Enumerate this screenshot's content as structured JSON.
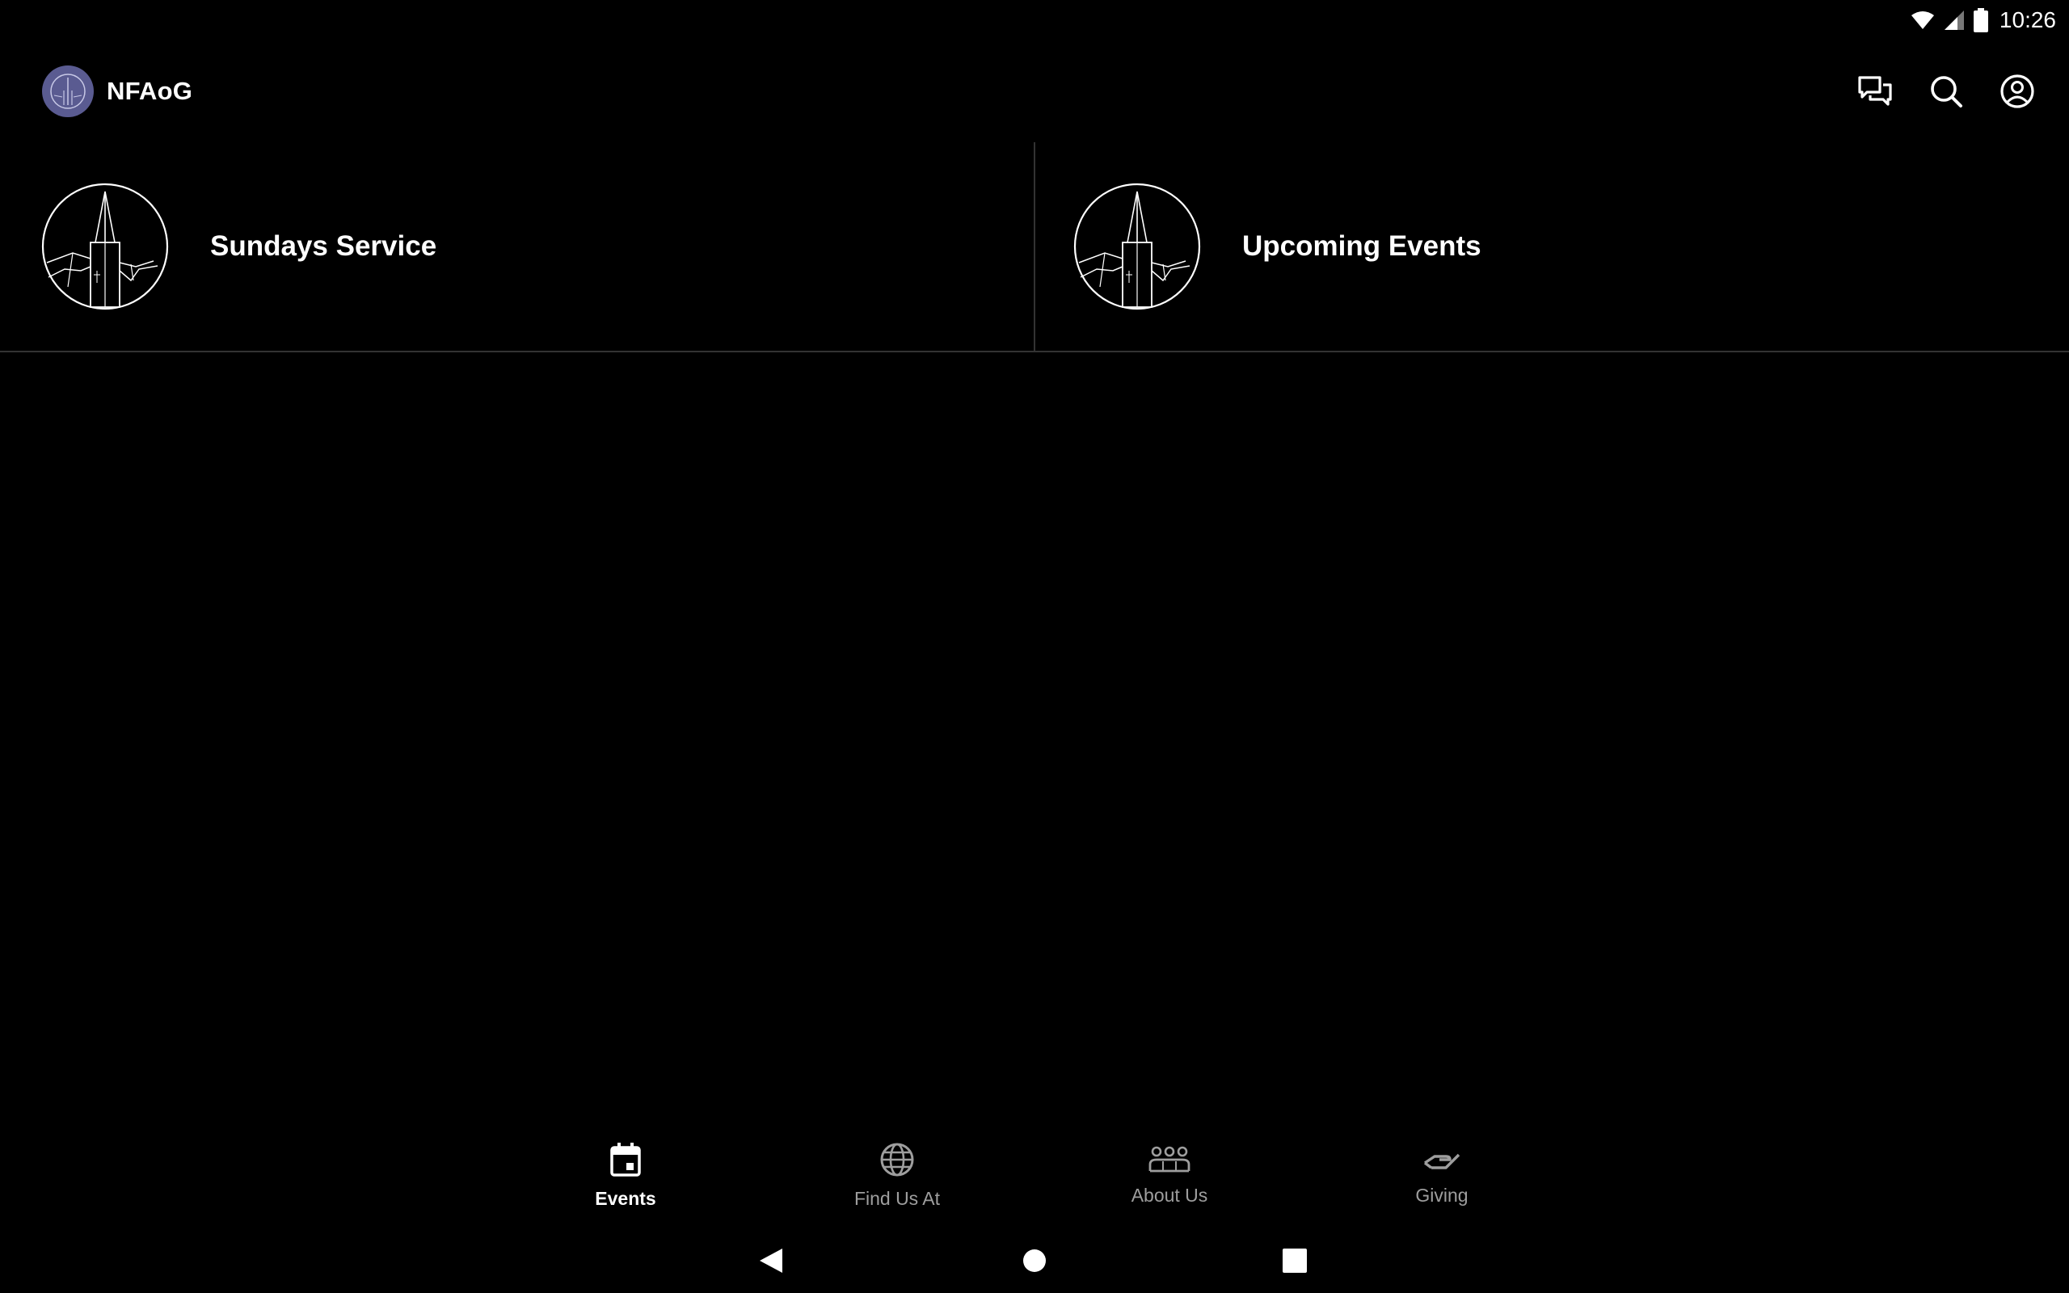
{
  "status_bar": {
    "time": "10:26",
    "icons": [
      "wifi-icon",
      "cellular-signal-icon",
      "battery-icon"
    ]
  },
  "app_bar": {
    "title": "NFAoG",
    "logo": "church-logo-icon",
    "actions": [
      {
        "name": "chat-icon"
      },
      {
        "name": "search-icon"
      },
      {
        "name": "account-icon"
      }
    ]
  },
  "categories": [
    {
      "label": "Sundays Service",
      "icon": "church-steeple-icon"
    },
    {
      "label": "Upcoming Events",
      "icon": "church-steeple-icon"
    }
  ],
  "bottom_nav": {
    "items": [
      {
        "label": "Events",
        "icon": "calendar-icon",
        "active": true
      },
      {
        "label": "Find Us At",
        "icon": "globe-icon",
        "active": false
      },
      {
        "label": "About Us",
        "icon": "people-group-icon",
        "active": false
      },
      {
        "label": "Giving",
        "icon": "giving-hand-icon",
        "active": false
      }
    ]
  },
  "system_nav": [
    "back-icon",
    "home-icon",
    "recents-icon"
  ],
  "colors": {
    "background": "#000000",
    "logo_bg": "#5a5b91",
    "inactive_nav": "#9e9e9e",
    "divider": "#333333"
  }
}
